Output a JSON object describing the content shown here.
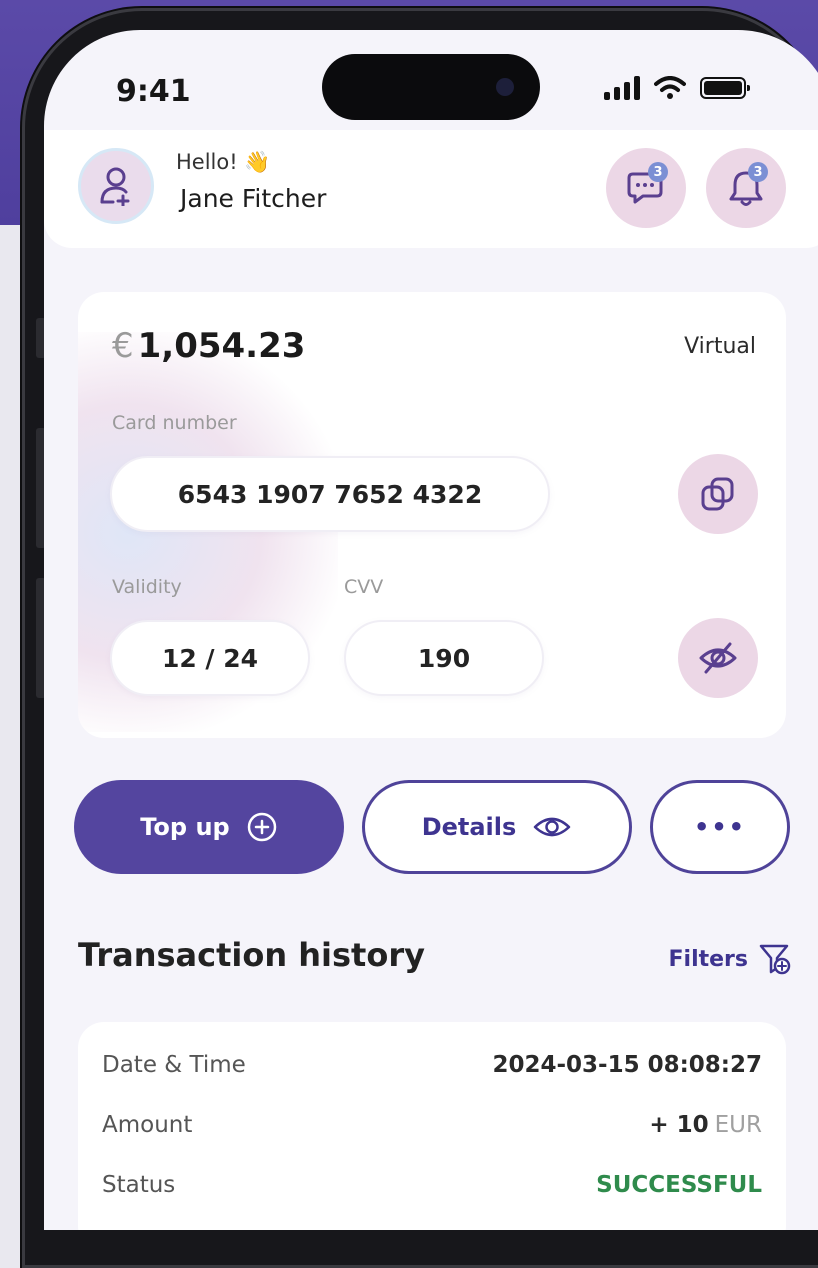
{
  "status_bar": {
    "time": "9:41"
  },
  "header": {
    "greeting": "Hello! 👋",
    "user_name": "Jane Fitcher",
    "chat_badge": "3",
    "bell_badge": "3"
  },
  "card": {
    "currency": "€",
    "balance": "1,054.23",
    "type": "Virtual",
    "card_number_label": "Card number",
    "card_number": "6543   1907   7652   4322",
    "validity_label": "Validity",
    "validity": "12  /  24",
    "cvv_label": "CVV",
    "cvv": "190"
  },
  "actions": {
    "top_up": "Top up",
    "details": "Details",
    "more": "•••"
  },
  "transactions": {
    "title": "Transaction history",
    "filters": "Filters",
    "rows": [
      {
        "label": "Date & Time",
        "value": "2024-03-15 08:08:27",
        "unit": ""
      },
      {
        "label": "Amount",
        "value": "+ 10",
        "unit": "EUR"
      },
      {
        "label": "Status",
        "value": "SUCCESSFUL",
        "unit": ""
      }
    ]
  },
  "colors": {
    "brand": "#54459f",
    "success": "#2f8b4c",
    "icon_bg": "#ecd7e6"
  }
}
